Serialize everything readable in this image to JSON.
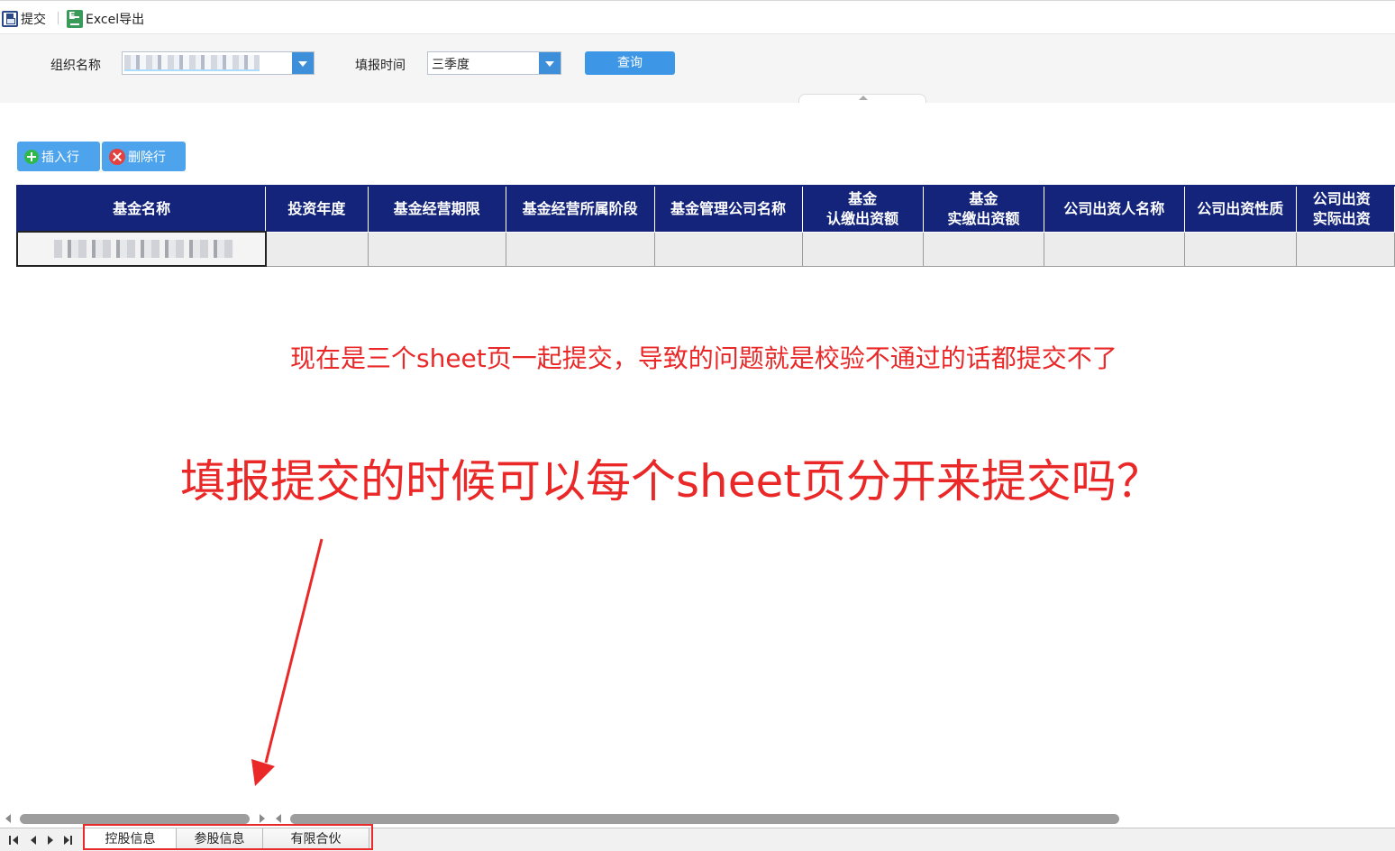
{
  "toolbar": {
    "submit_label": "提交",
    "save_icon": "save-icon",
    "excel_export_label": "Excel导出",
    "excel_icon": "excel-icon"
  },
  "query": {
    "org_label": "组织名称",
    "org_value": "",
    "period_label": "填报时间",
    "period_value": "三季度",
    "search_label": "查询"
  },
  "actions": {
    "insert_row_label": "插入行",
    "delete_row_label": "删除行"
  },
  "table": {
    "headers": [
      [
        "基金名称"
      ],
      [
        "投资年度"
      ],
      [
        "基金经营期限"
      ],
      [
        "基金经营所属阶段"
      ],
      [
        "基金管理公司名称"
      ],
      [
        "基金",
        "认缴出资额"
      ],
      [
        "基金",
        "实缴出资额"
      ],
      [
        "公司出资人名称"
      ],
      [
        "公司出资性质"
      ],
      [
        "公司出资",
        "实际出资"
      ]
    ],
    "header_color": "#13247a"
  },
  "annotations": {
    "note_small": "现在是三个sheet页一起提交，导致的问题就是校验不通过的话都提交不了",
    "note_big": "填报提交的时候可以每个sheet页分开来提交吗？",
    "note_color": "#ea2828"
  },
  "sheets": [
    {
      "label": "控股信息",
      "active": true
    },
    {
      "label": "参股信息",
      "active": false
    },
    {
      "label": "有限合伙",
      "active": false
    }
  ]
}
